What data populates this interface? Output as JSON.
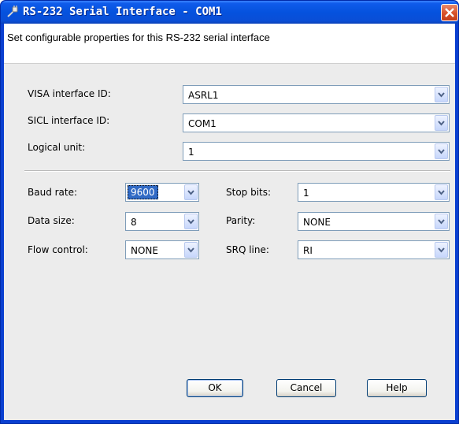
{
  "window": {
    "title": "RS-232 Serial Interface - COM1"
  },
  "header": {
    "description": "Set configurable properties for this RS-232 serial interface"
  },
  "visa_id": {
    "label": "VISA interface ID:",
    "value": "ASRL1"
  },
  "sicl_id": {
    "label": "SICL interface ID:",
    "value": "COM1"
  },
  "logical_unit": {
    "label": "Logical unit:",
    "value": "1"
  },
  "baud_rate": {
    "label": "Baud rate:",
    "value": "9600"
  },
  "data_size": {
    "label": "Data size:",
    "value": "8"
  },
  "flow_control": {
    "label": "Flow control:",
    "value": "NONE"
  },
  "stop_bits": {
    "label": "Stop bits:",
    "value": "1"
  },
  "parity": {
    "label": "Parity:",
    "value": "NONE"
  },
  "srq_line": {
    "label": "SRQ line:",
    "value": "RI"
  },
  "buttons": {
    "ok": "OK",
    "cancel": "Cancel",
    "help": "Help"
  },
  "icons": {
    "title": "connector-icon",
    "close": "close-icon",
    "dropdown": "chevron-down-icon"
  },
  "colors": {
    "titlebar": "#0552de",
    "close": "#d7512a",
    "selection": "#316ac5",
    "dialog_bg": "#ececec"
  }
}
